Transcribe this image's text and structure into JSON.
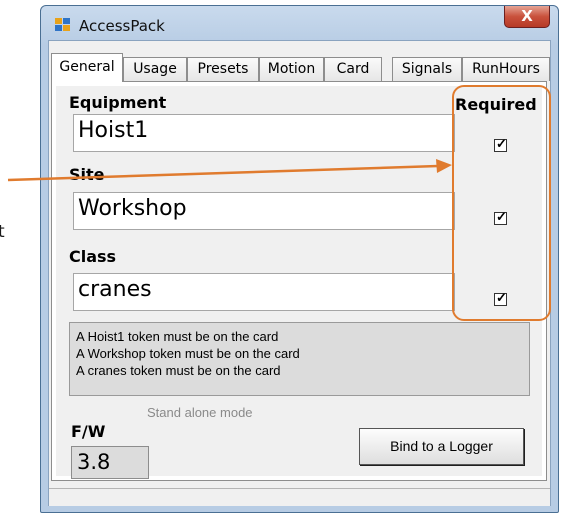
{
  "left_text": "t",
  "window": {
    "title": "AccessPack",
    "close_glyph": "X"
  },
  "tabs": [
    {
      "label": "General",
      "active": true
    },
    {
      "label": "Usage",
      "active": false
    },
    {
      "label": "Presets",
      "active": false
    },
    {
      "label": "Motion",
      "active": false
    },
    {
      "label": "Card",
      "active": false
    },
    {
      "label": "Signals",
      "active": false
    },
    {
      "label": "RunHours",
      "active": false
    }
  ],
  "general": {
    "required_label": "Required",
    "equipment": {
      "label": "Equipment",
      "value": "Hoist1",
      "required": true
    },
    "site": {
      "label": "Site",
      "value": "Workshop",
      "required": true
    },
    "class": {
      "label": "Class",
      "value": "cranes",
      "required": true
    },
    "messages": [
      "A Hoist1 token must be on the card",
      "A Workshop token must be on the card",
      "A cranes token must be on the card"
    ],
    "mode_hint": "Stand alone mode",
    "fw_label": "F/W",
    "fw_value": "3.8",
    "bind_button": "Bind to a Logger"
  },
  "colors": {
    "annotation": "#e07b2e",
    "titlebar": "#b7cce4",
    "close": "#c9513c"
  },
  "icons": [
    "app-icon",
    "close-icon",
    "check-icon",
    "arrow-annotation-icon"
  ]
}
